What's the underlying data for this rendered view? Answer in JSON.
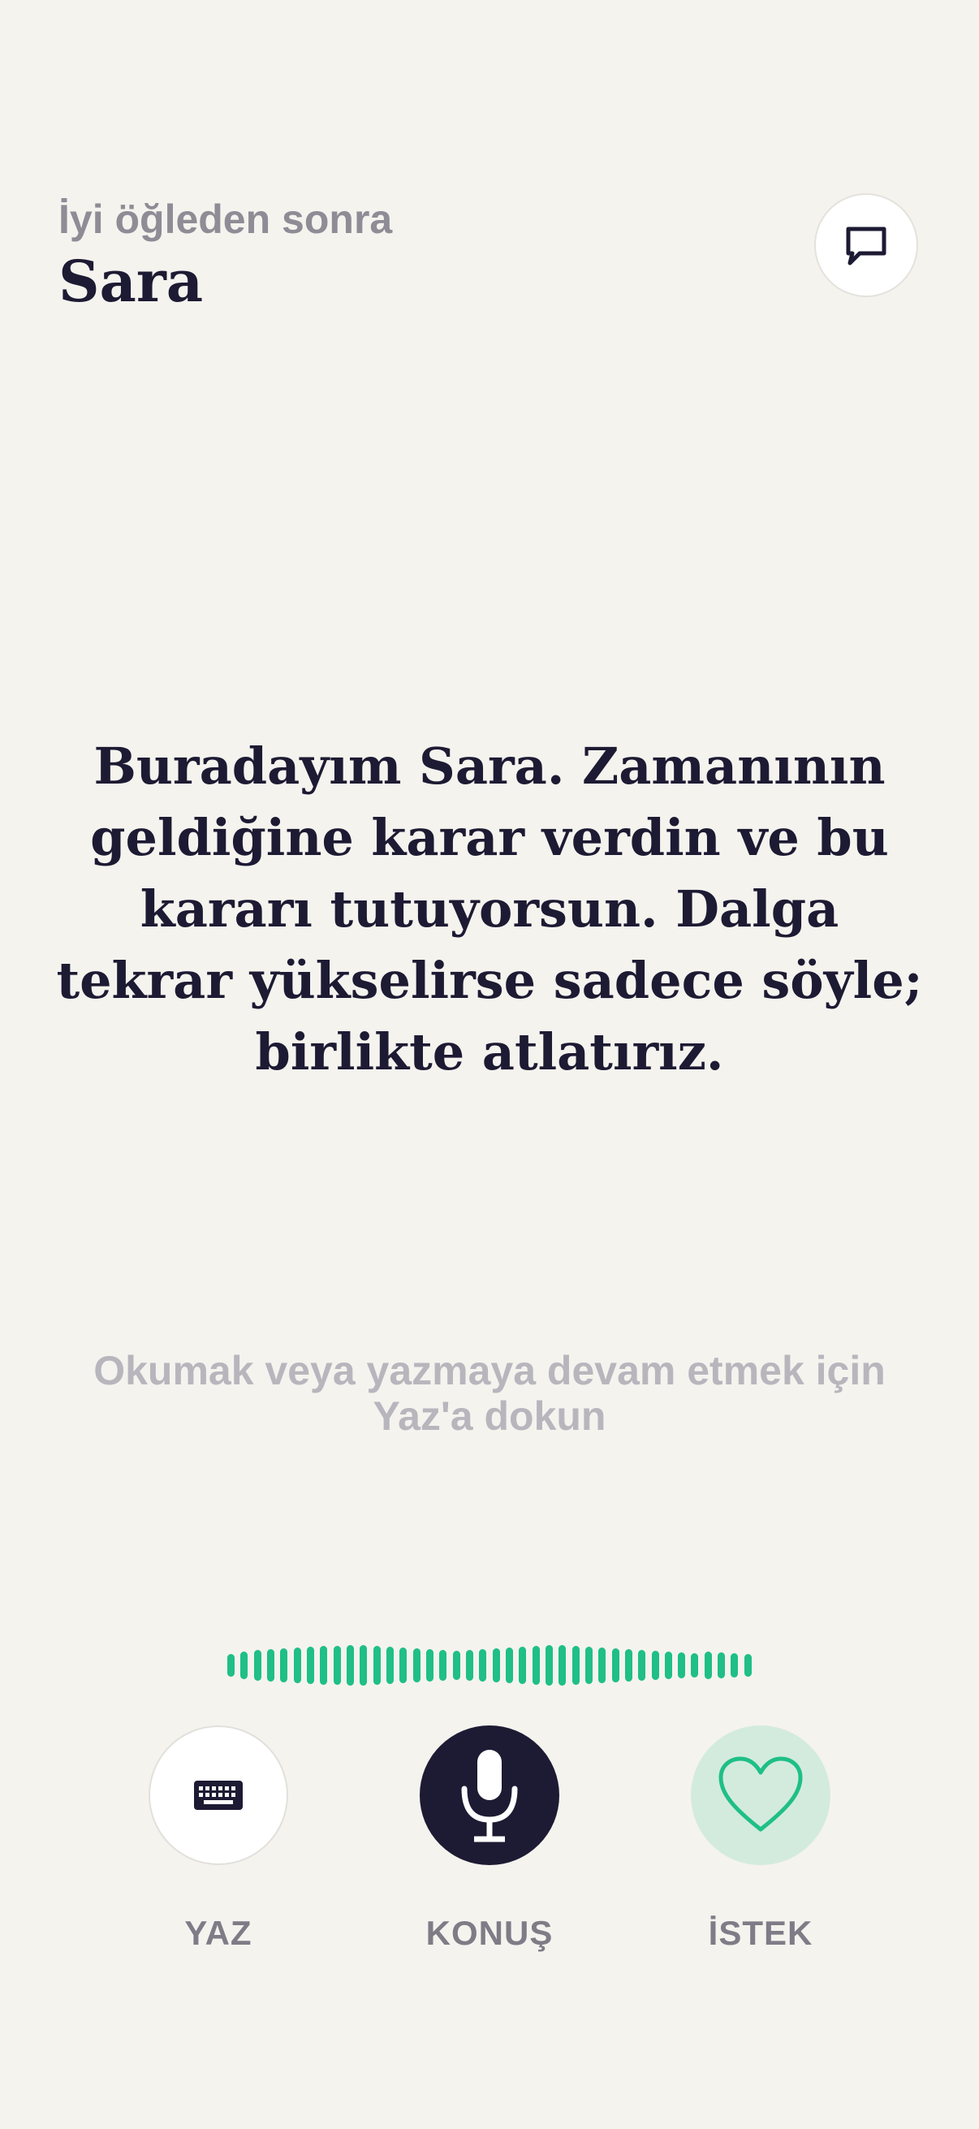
{
  "header": {
    "greeting": "İyi öğleden sonra",
    "name": "Sara",
    "chat_icon": "chat-bubble-icon"
  },
  "main": {
    "message": "Buradayım Sara. Zamanının geldiğine karar verdin ve bu kararı tutuyorsun. Dalga tekrar yükselirse sadece söyle; birlikte atlatırız.",
    "hint": "Okumak veya yazmaya devam etmek için Yaz'a dokun"
  },
  "voice": {
    "waveform_icon": "audio-waveform",
    "color": "#1fbf87"
  },
  "actions": {
    "write": {
      "label": "YAZ",
      "icon": "keyboard-icon"
    },
    "speak": {
      "label": "KONUŞ",
      "icon": "microphone-icon",
      "active": true
    },
    "request": {
      "label": "İSTEK",
      "icon": "heart-icon"
    }
  },
  "colors": {
    "background": "#f5f3ee",
    "text_dark": "#1d1a33",
    "accent_green": "#1fbf87",
    "muted": "#8e8c95"
  }
}
